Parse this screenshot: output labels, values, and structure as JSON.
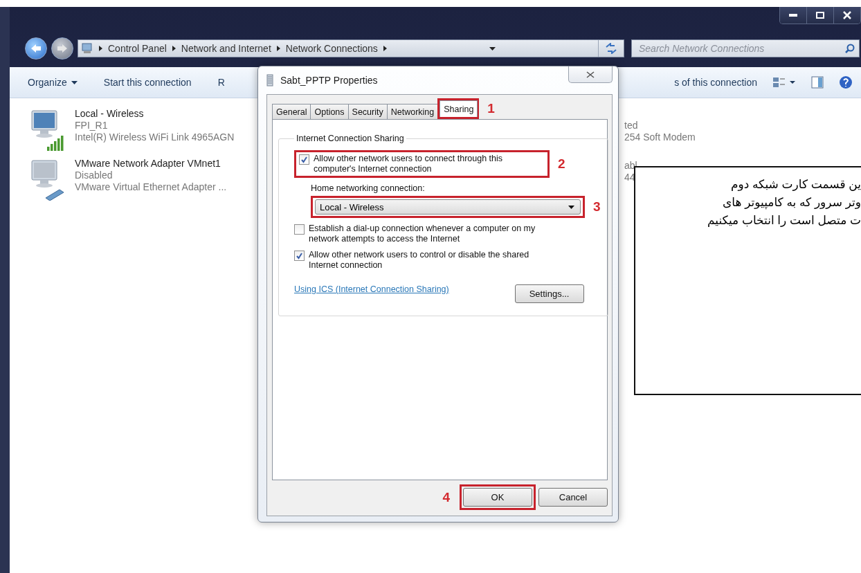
{
  "window": {
    "breadcrumb": [
      "Control Panel",
      "Network and Internet",
      "Network Connections"
    ],
    "search": {
      "placeholder": "Search Network Connections"
    }
  },
  "toolbar": {
    "items": [
      "Organize",
      "Start this connection",
      "R"
    ],
    "right_text": "s of this connection"
  },
  "connections": [
    {
      "kind": "wireless",
      "name": "Local - Wireless",
      "status": "FPI_R1",
      "device": "Intel(R) Wireless WiFi Link 4965AGN"
    },
    {
      "kind": "ethernet",
      "name": "VMware Network Adapter VMnet1",
      "status": "Disabled",
      "device": "VMware Virtual Ethernet Adapter ..."
    }
  ],
  "connections_column_2": [
    {
      "status": "ted",
      "device": "254 Soft Modem"
    },
    {
      "status": "abl",
      "device": "44"
    }
  ],
  "dialog": {
    "title": "Sabt_PPTP Properties",
    "tabs": [
      {
        "label": "General",
        "selected": false,
        "highlighted": false
      },
      {
        "label": "Options",
        "selected": false,
        "highlighted": false
      },
      {
        "label": "Security",
        "selected": false,
        "highlighted": false
      },
      {
        "label": "Networking",
        "selected": false,
        "highlighted": false
      },
      {
        "label": "Sharing",
        "selected": true,
        "highlighted": true,
        "step": "1"
      }
    ],
    "group_title": "Internet Connection Sharing",
    "options": [
      {
        "kind": "checkbox",
        "label": "Allow other network users to connect through this computer's Internet connection",
        "checked": true,
        "highlighted": true,
        "step": "2"
      },
      {
        "kind": "dropdown",
        "caption": "Home networking connection:",
        "value": "Local - Wireless",
        "highlighted": true,
        "step": "3"
      },
      {
        "kind": "checkbox",
        "label": "Establish a dial-up connection whenever a computer on my network attempts to access the Internet",
        "checked": false,
        "highlighted": false
      },
      {
        "kind": "checkbox",
        "label": "Allow other network users to control or disable the shared Internet connection",
        "checked": true,
        "highlighted": false
      }
    ],
    "link": "Using ICS (Internet Connection Sharing)",
    "settings_button": "Settings...",
    "buttons": [
      {
        "label": "OK",
        "highlighted": true,
        "step": "4"
      },
      {
        "label": "Cancel",
        "highlighted": false
      }
    ]
  },
  "note": {
    "lines": [
      "ین قسمت کارت شبکه دوم",
      "وتر سرور که به کامپیوتر های",
      "ت متصل است را انتخاب میکنیم"
    ]
  }
}
